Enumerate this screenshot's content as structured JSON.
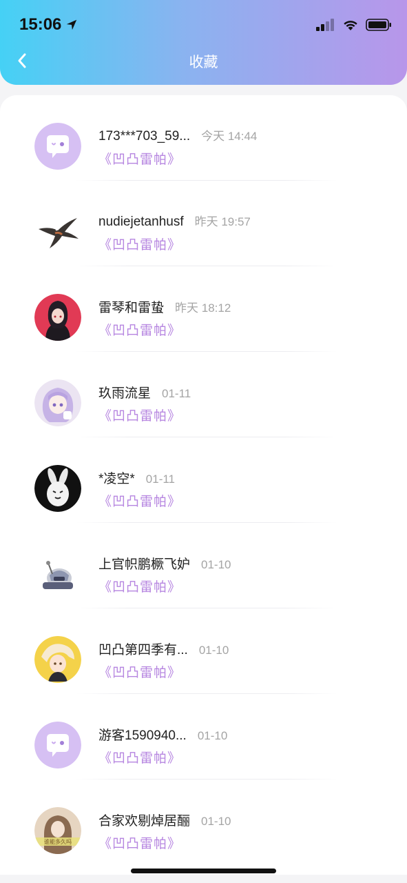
{
  "status_bar": {
    "time": "15:06"
  },
  "nav": {
    "title": "收藏"
  },
  "items": [
    {
      "name": "173***703_59...",
      "time": "今天 14:44",
      "subtitle": "《凹凸雷帕》",
      "avatar": "chat-bubble-avatar"
    },
    {
      "name": "nudiejetanhusf",
      "time": "昨天 19:57",
      "subtitle": "《凹凸雷帕》",
      "avatar": "swallow-bird-avatar"
    },
    {
      "name": "雷琴和雷蛰",
      "time": "昨天 18:12",
      "subtitle": "《凹凸雷帕》",
      "avatar": "anime-girl-red-avatar"
    },
    {
      "name": "玖雨流星",
      "time": "01-11",
      "subtitle": "《凹凸雷帕》",
      "avatar": "anime-girl-purple-avatar"
    },
    {
      "name": "*凌空*",
      "time": "01-11",
      "subtitle": "《凹凸雷帕》",
      "avatar": "bunny-avatar"
    },
    {
      "name": "上官帜鹏橛飞妒",
      "time": "01-10",
      "subtitle": "《凹凸雷帕》",
      "avatar": "robot-avatar"
    },
    {
      "name": "凹凸第四季有...",
      "time": "01-10",
      "subtitle": "《凹凸雷帕》",
      "avatar": "anime-yellow-avatar"
    },
    {
      "name": "游客1590940...",
      "time": "01-10",
      "subtitle": "《凹凸雷帕》",
      "avatar": "chat-bubble-avatar"
    },
    {
      "name": "合家欢剔焯居酾",
      "time": "01-10",
      "subtitle": "《凹凸雷帕》",
      "avatar": "portrait-avatar",
      "avatar_caption": "谁能多久吗"
    }
  ]
}
